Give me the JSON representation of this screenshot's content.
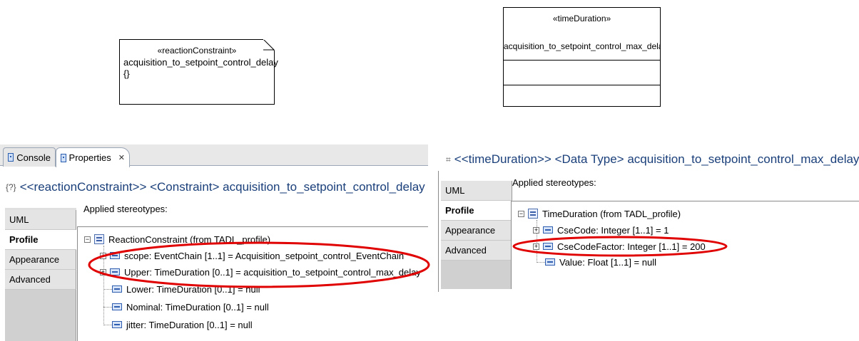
{
  "diagram": {
    "note": {
      "stereotype": "«reactionConstraint»",
      "name": "acquisition_to_setpoint_control_delay",
      "body": "{}"
    },
    "class_box": {
      "stereotype": "«timeDuration»",
      "name": "acquisition_to_setpoint_control_max_delay"
    }
  },
  "left_panel": {
    "tabs": {
      "console": "Console",
      "properties": "Properties",
      "close_glyph": "✕"
    },
    "title_icon": "{?}",
    "title": "<<reactionConstraint>> <Constraint> acquisition_to_setpoint_control_delay",
    "vertical_tabs": [
      "UML",
      "Profile",
      "Appearance",
      "Advanced"
    ],
    "active_tab": "Profile",
    "applied_label": "Applied stereotypes:",
    "tree": {
      "root": "ReactionConstraint   (from TADL_profile)",
      "children": [
        {
          "label": "scope: EventChain [1..1] = Acquisition_setpoint_control_EventChain",
          "expandable": true
        },
        {
          "label": "Upper: TimeDuration [0..1] = acquisition_to_setpoint_control_max_delay",
          "expandable": true
        },
        {
          "label": "Lower: TimeDuration [0..1] = null",
          "expandable": false
        },
        {
          "label": "Nominal: TimeDuration [0..1] = null",
          "expandable": false
        },
        {
          "label": "jitter: TimeDuration [0..1] = null",
          "expandable": false
        }
      ]
    }
  },
  "right_panel": {
    "title_icon": "⌗",
    "title": "<<timeDuration>> <Data Type> acquisition_to_setpoint_control_max_delay",
    "vertical_tabs": [
      "UML",
      "Profile",
      "Appearance",
      "Advanced"
    ],
    "active_tab": "Profile",
    "applied_label": "Applied stereotypes:",
    "tree": {
      "root": "TimeDuration   (from TADL_profile)",
      "children": [
        {
          "label": "CseCode: Integer [1..1] = 1",
          "expandable": true
        },
        {
          "label": "CseCodeFactor: Integer [1..1] = 200",
          "expandable": true
        },
        {
          "label": "Value: Float [1..1] = null",
          "expandable": false
        }
      ]
    }
  },
  "colors": {
    "title_text": "#1a3f7a",
    "annotation_red": "#e00000",
    "tab_background": "#e4e4e4"
  }
}
